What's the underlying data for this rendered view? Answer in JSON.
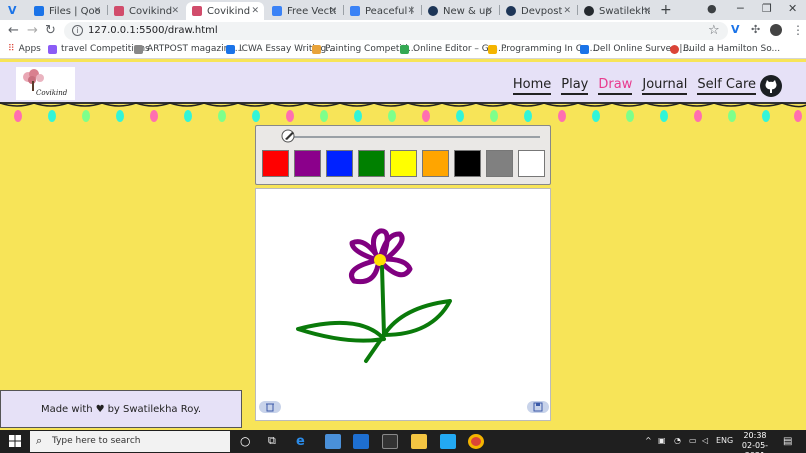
{
  "browser": {
    "tabs": [
      {
        "label": "Files | Qoom",
        "color": "#1a73e8"
      },
      {
        "label": "Covikind",
        "color": "#d14c6b"
      },
      {
        "label": "Covikind",
        "color": "#d14c6b",
        "active": true
      },
      {
        "label": "Free Vector",
        "color": "#3b82f6"
      },
      {
        "label": "Peaceful lan",
        "color": "#3b82f6"
      },
      {
        "label": "New & upco",
        "color": "#1d3557"
      },
      {
        "label": "Devpost",
        "color": "#1d3557"
      },
      {
        "label": "Swatilekha-R",
        "color": "#24292e"
      }
    ],
    "url": "127.0.0.1:5500/draw.html",
    "bookmarks": [
      {
        "label": "Apps",
        "color": "#db4437"
      },
      {
        "label": "travel Competitions",
        "color": "#8b5cf6"
      },
      {
        "label": "ARTPOST magazine...",
        "color": "#888888"
      },
      {
        "label": "ICWA Essay Writing...",
        "color": "#1a73e8"
      },
      {
        "label": "Painting Competiti...",
        "color": "#e8a33a"
      },
      {
        "label": "Online Editor – Gra...",
        "color": "#34a853"
      },
      {
        "label": "Programming In C+...",
        "color": "#f4b400"
      },
      {
        "label": "Dell Online Survey |...",
        "color": "#1a73e8"
      },
      {
        "label": "Build a Hamilton So...",
        "color": "#db4437"
      }
    ]
  },
  "site": {
    "logo_text": "Covikind",
    "nav": {
      "home": "Home",
      "play": "Play",
      "draw": "Draw",
      "journal": "Journal",
      "selfcare": "Self Care"
    },
    "accent_color": "#e83a8d",
    "background_color": "#f7e458",
    "nav_bg_color": "#e6e1f7"
  },
  "palette": {
    "colors": [
      "#ff0000",
      "#8b008b",
      "#0022ff",
      "#008000",
      "#ffff00",
      "#ffa500",
      "#000000",
      "#808080",
      "#ffffff"
    ]
  },
  "footer": {
    "prefix": "Made with",
    "suffix": "by Swatilekha Roy."
  },
  "taskbar": {
    "search_placeholder": "Type here to search",
    "language": "ENG",
    "time": "20:38",
    "date": "02-05-2021"
  }
}
